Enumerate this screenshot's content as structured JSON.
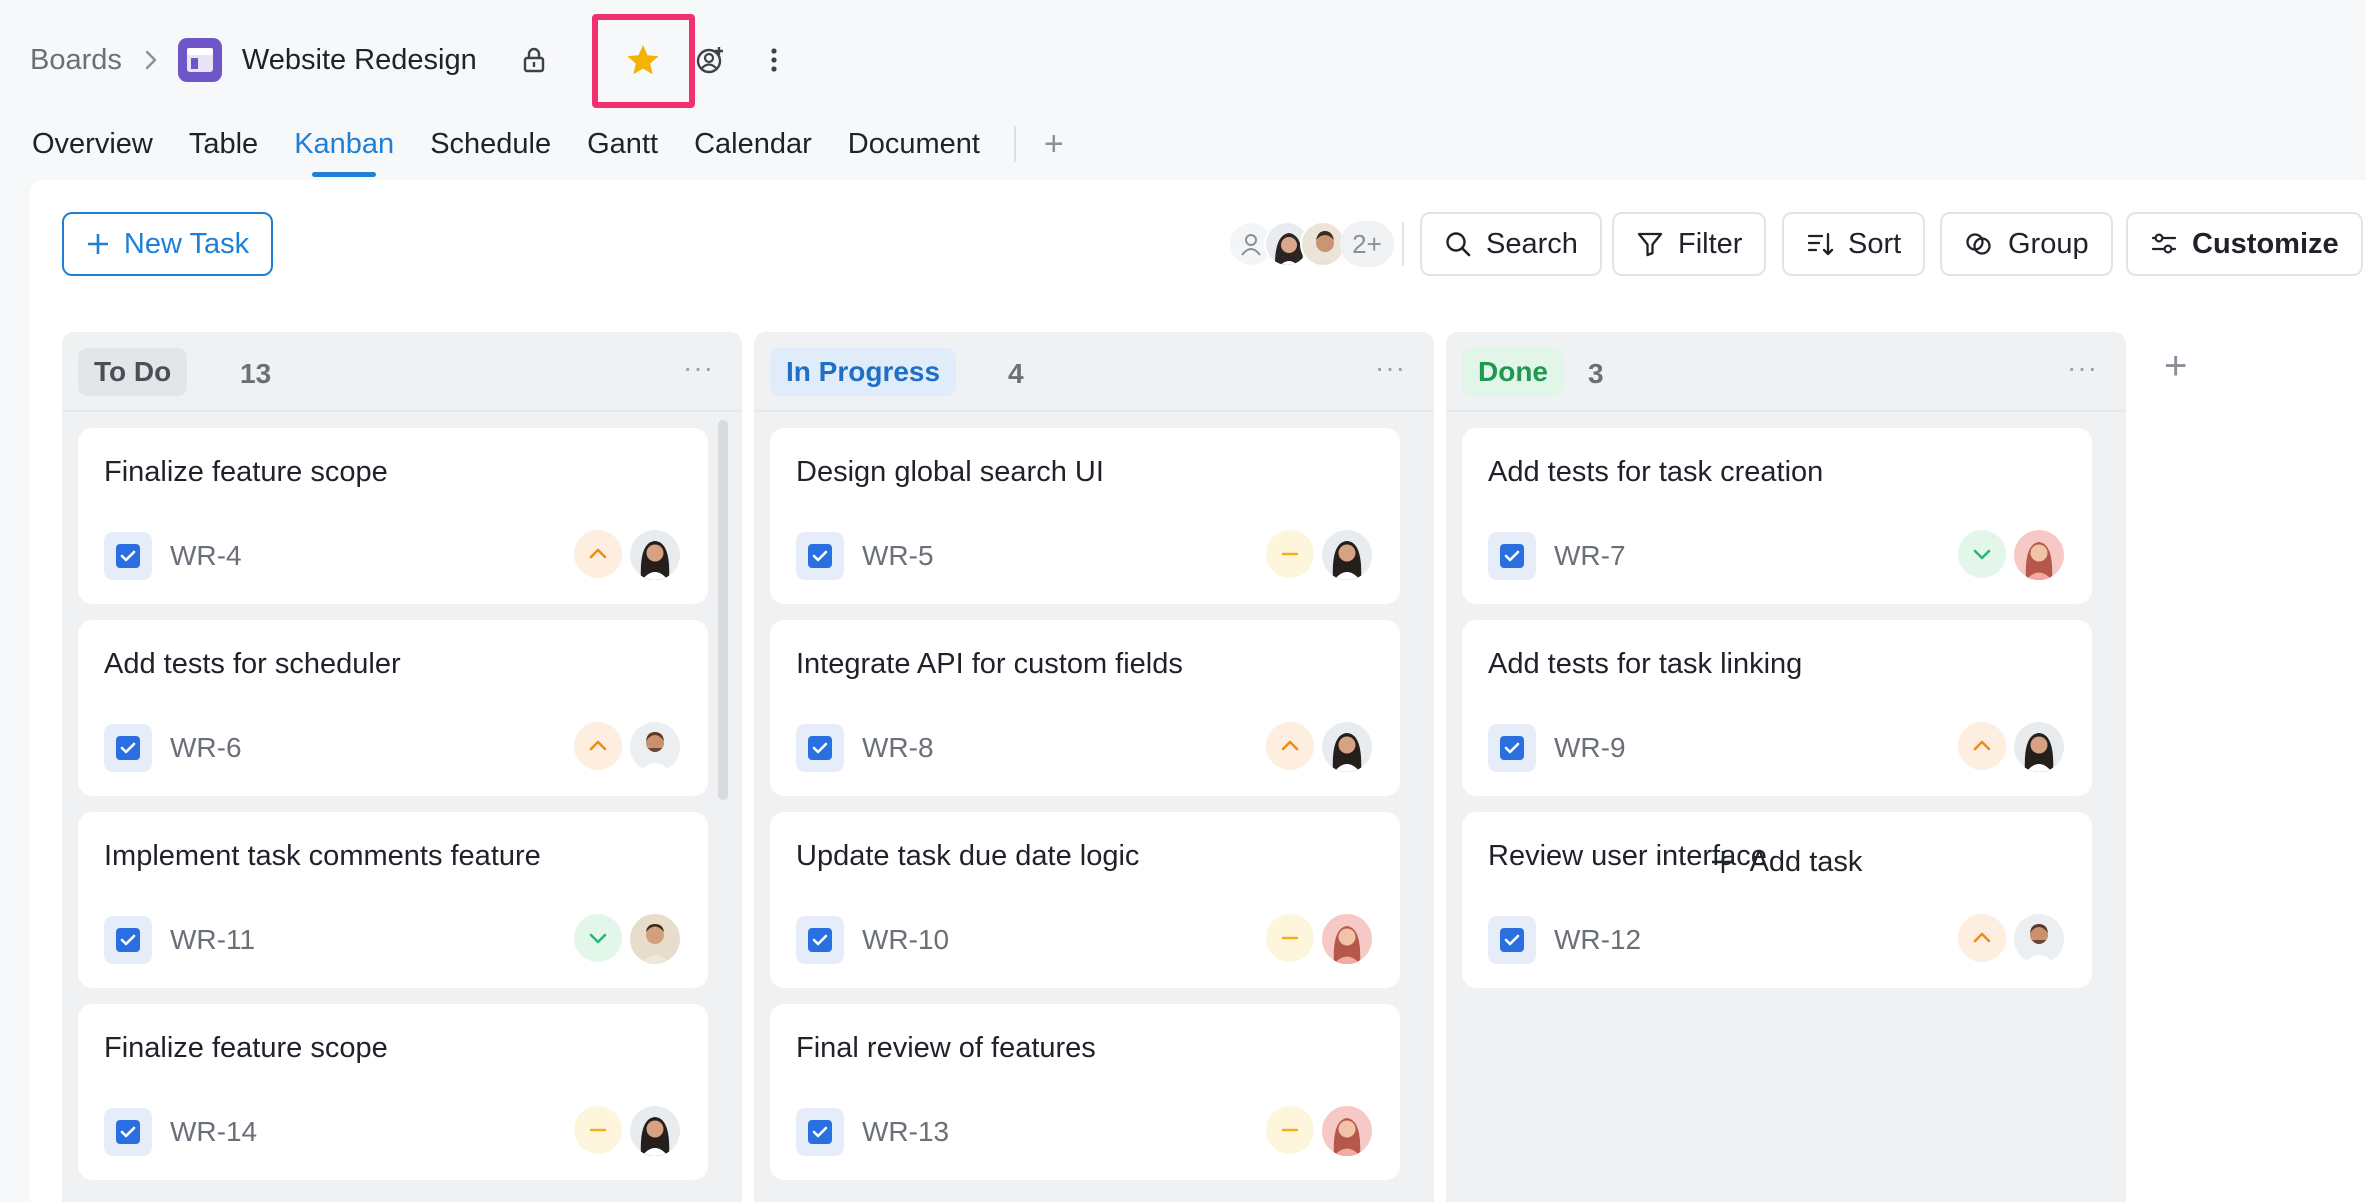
{
  "breadcrumb": {
    "root": "Boards",
    "board_title": "Website Redesign"
  },
  "tabs": [
    {
      "label": "Overview"
    },
    {
      "label": "Table"
    },
    {
      "label": "Kanban"
    },
    {
      "label": "Schedule"
    },
    {
      "label": "Gantt"
    },
    {
      "label": "Calendar"
    },
    {
      "label": "Document"
    }
  ],
  "active_tab": "Kanban",
  "toolbar": {
    "new_task": "New Task",
    "members_more": "2+",
    "search": "Search",
    "filter": "Filter",
    "sort": "Sort",
    "group": "Group",
    "customize": "Customize"
  },
  "colors": {
    "accent": "#1f7fd6",
    "board_icon": "#6f56c8",
    "star": "#f5b301",
    "highlight": "#f2306e",
    "priority_high": "#f08a1c",
    "priority_medium": "#f3b21b",
    "priority_low": "#2bb673"
  },
  "columns": [
    {
      "name": "To Do",
      "count": "13",
      "cards": [
        {
          "title": "Finalize feature scope",
          "id": "WR-4",
          "priority": "high",
          "assignee": "woman-dark-hair"
        },
        {
          "title": "Add tests for scheduler",
          "id": "WR-6",
          "priority": "high",
          "assignee": "man-beard"
        },
        {
          "title": "Implement task comments feature",
          "id": "WR-11",
          "priority": "low",
          "assignee": "man-young"
        },
        {
          "title": "Finalize feature scope",
          "id": "WR-14",
          "priority": "medium",
          "assignee": "woman-dark-hair"
        }
      ]
    },
    {
      "name": "In Progress",
      "count": "4",
      "cards": [
        {
          "title": "Design global search UI",
          "id": "WR-5",
          "priority": "medium",
          "assignee": "woman-dark-hair"
        },
        {
          "title": "Integrate API for custom fields",
          "id": "WR-8",
          "priority": "high",
          "assignee": "woman-dark-hair"
        },
        {
          "title": "Update task due date logic",
          "id": "WR-10",
          "priority": "medium",
          "assignee": "woman-pink"
        },
        {
          "title": "Final review of features",
          "id": "WR-13",
          "priority": "medium",
          "assignee": "woman-pink"
        }
      ]
    },
    {
      "name": "Done",
      "count": "3",
      "cards": [
        {
          "title": "Add tests for task creation",
          "id": "WR-7",
          "priority": "low",
          "assignee": "woman-pink"
        },
        {
          "title": "Add tests for task linking",
          "id": "WR-9",
          "priority": "high",
          "assignee": "woman-dark-hair"
        },
        {
          "title": "Review user interface",
          "id": "WR-12",
          "priority": "high",
          "assignee": "man-beard"
        }
      ],
      "add_task": "Add task"
    }
  ]
}
